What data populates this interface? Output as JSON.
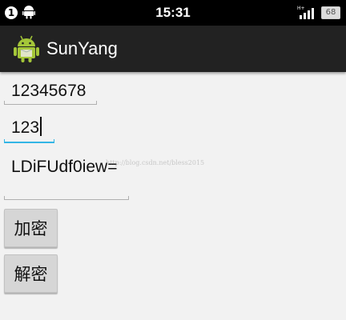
{
  "status_bar": {
    "notification_count": "1",
    "time": "15:31",
    "network_label": "H+",
    "battery": "68"
  },
  "action_bar": {
    "title": "SunYang",
    "icon": "android-icon"
  },
  "form": {
    "plain_text": "12345678",
    "key": "123",
    "result": "LDiFUdf0iew=",
    "fourth_field": ""
  },
  "buttons": {
    "encrypt": "加密",
    "decrypt": "解密"
  },
  "watermark": "http://blog.csdn.net/bless2015",
  "colors": {
    "status_bar": "#000000",
    "action_bar": "#222222",
    "background": "#f2f2f2",
    "focus_underline": "#33b5e5",
    "button": "#d6d6d6",
    "android_green": "#a4c639"
  }
}
